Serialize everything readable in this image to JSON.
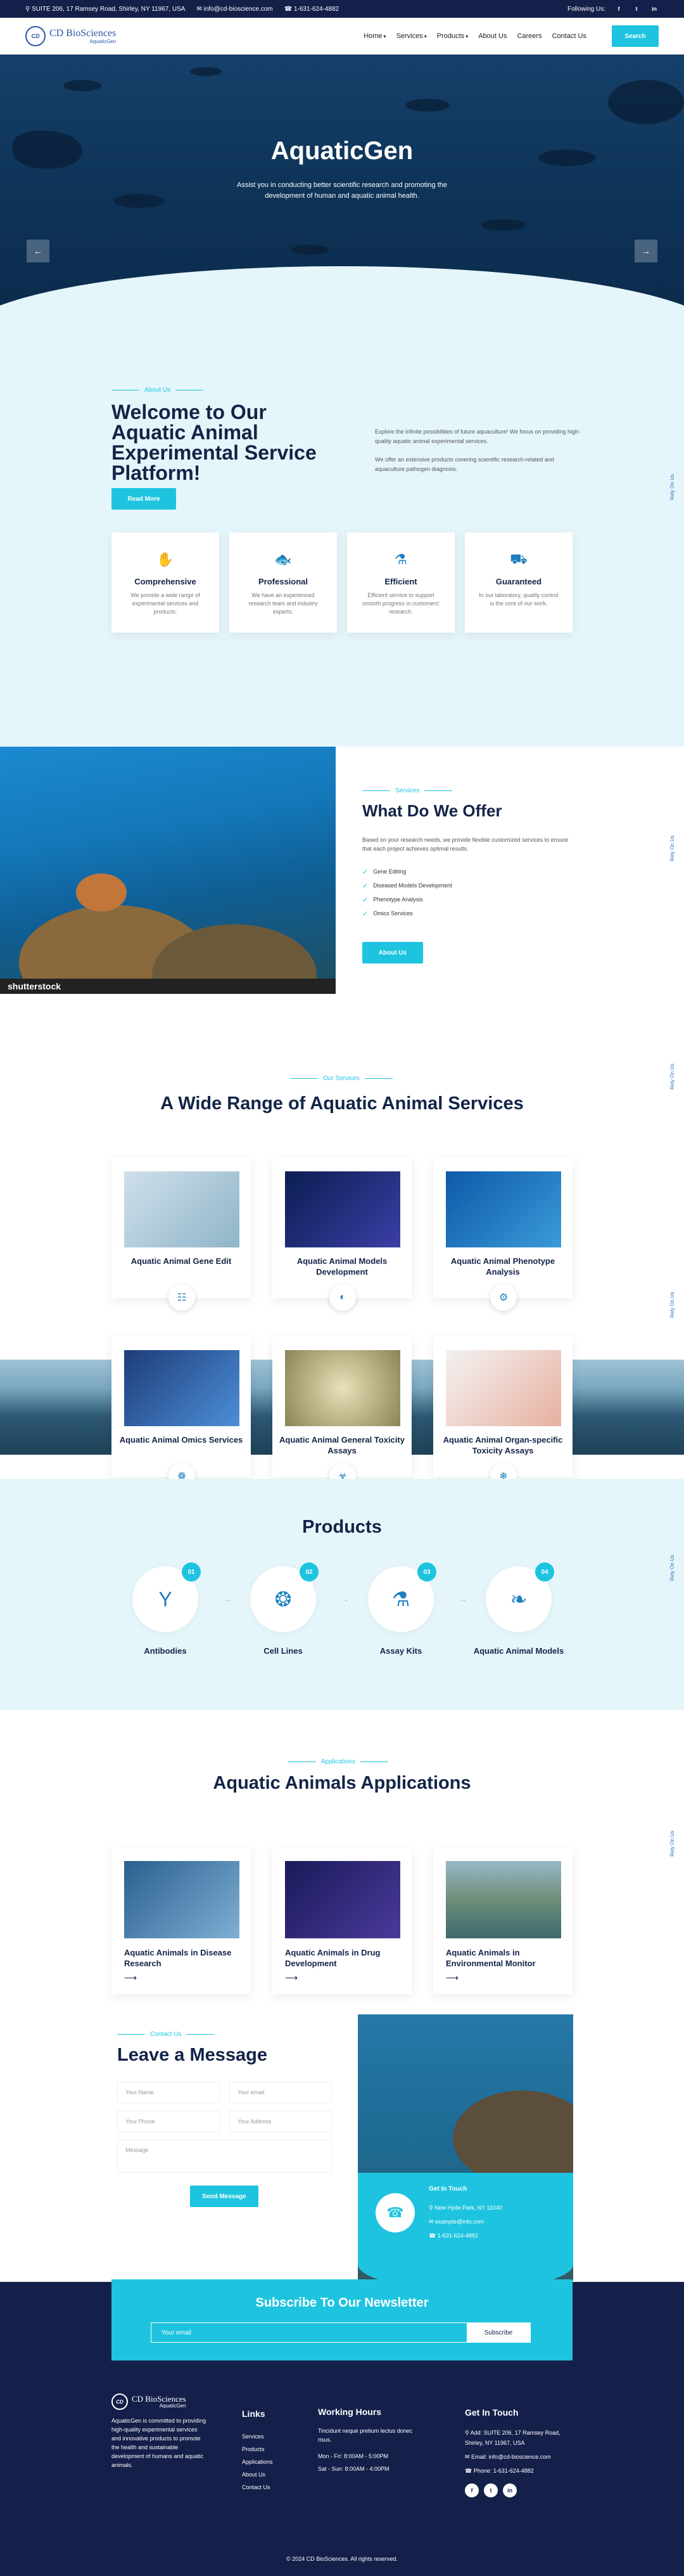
{
  "topbar": {
    "address": "SUITE 206, 17 Ramsey Road, Shirley, NY 11967, USA",
    "email": "info@cd-bioscience.com",
    "phone": "1-631-624-4882",
    "follow": "Following Us:"
  },
  "header": {
    "logo": "CD BioSciences",
    "logo_sub": "AquaticGen",
    "nav": [
      "Home",
      "Services",
      "Products",
      "About Us",
      "Careers",
      "Contact Us"
    ],
    "search": "Search"
  },
  "hero": {
    "title": "AquaticGen",
    "subtitle": "Assist you in conducting better scientific research and promoting the development of human and aquatic animal health."
  },
  "about": {
    "kicker": "About Us",
    "title": "Welcome to Our Aquatic Animal Experimental Service Platform!",
    "desc1": "Explore the infinite possibilities of future aquaculture! We focus on providing high-quality aquatic animal experimental services.",
    "desc2": "We offer an extensive products covering scientific research-related and aquaculture pathogen diagnosis.",
    "button": "Read More",
    "features": [
      {
        "title": "Comprehensive",
        "text": "We provide a wide range of experimental services and products."
      },
      {
        "title": "Professional",
        "text": "We have an experienced research team and industry experts."
      },
      {
        "title": "Efficient",
        "text": "Efficient service to support smooth progress in customers' research."
      },
      {
        "title": "Guaranteed",
        "text": "In our laboratory, quality control is the core of our work."
      }
    ]
  },
  "offer": {
    "kicker": "Services",
    "title": "What Do We Offer",
    "text": "Based on your research needs, we provide flexible customized services to ensure that each project achieves optimal results.",
    "items": [
      "Gene Editing",
      "Diseased Models Development",
      "Phenotype Analysis",
      "Omics Services"
    ],
    "button": "About Us",
    "watermark": "shutterstock"
  },
  "services": {
    "kicker": "Our Services",
    "title": "A Wide Range of Aquatic Animal Services",
    "items": [
      "Aquatic Animal Gene Edit",
      "Aquatic Animal Models Development",
      "Aquatic Animal Phenotype Analysis",
      "Aquatic Animal Omics Services",
      "Aquatic Animal General Toxicity Assays",
      "Aquatic Animal Organ-specific Toxicity Assays"
    ]
  },
  "products": {
    "title": "Products",
    "items": [
      {
        "num": "01",
        "label": "Antibodies"
      },
      {
        "num": "02",
        "label": "Cell Lines"
      },
      {
        "num": "03",
        "label": "Assay Kits"
      },
      {
        "num": "04",
        "label": "Aquatic Animal Models"
      }
    ]
  },
  "apps": {
    "kicker": "Applications",
    "title": "Aquatic Animals Applications",
    "items": [
      "Aquatic Animals in Disease Research",
      "Aquatic Animals in Drug Development",
      "Aquatic Animals in Environmental Monitor"
    ]
  },
  "contact": {
    "kicker": "Contact Us",
    "title": "Leave a Message",
    "name": "Your Name",
    "email": "Your email",
    "phone": "Your Phone",
    "address": "Your Address",
    "message": "Message",
    "button": "Send Message",
    "panel_title": "Get In Touch",
    "panel_addr": "New Hyde Park, NY 11040",
    "panel_email": "example@info.com",
    "panel_phone": "1-631-624-4882"
  },
  "newsletter": {
    "title": "Subscribe To Our Newsletter",
    "placeholder": "Your email",
    "button": "Subscribe"
  },
  "footer": {
    "about": "AquaticGen is committed to providing high-quality experimental services and innovative products to promote the health and sustainable development of humans and aquatic animals.",
    "links_title": "Links",
    "links": [
      "Services",
      "Products",
      "Applications",
      "About Us",
      "Contact Us"
    ],
    "hours_title": "Working Hours",
    "hours_text": "Tincidunt neque pretium lectus donec risus.",
    "hours1": "Mon - Fri: 8:00AM - 5:00PM",
    "hours2": "Sat - Sun: 8:00AM - 4:00PM",
    "touch_title": "Get In Touch",
    "addr": "Add: SUITE 206, 17 Ramsey Road, Shirley, NY 11967, USA",
    "email": "Email: info@cd-bioscience.com",
    "phone": "Phone: 1-631-624-4882",
    "copyright": "© 2024 CD BioSciences. All rights reserved."
  },
  "side_note": "Rely On Us"
}
